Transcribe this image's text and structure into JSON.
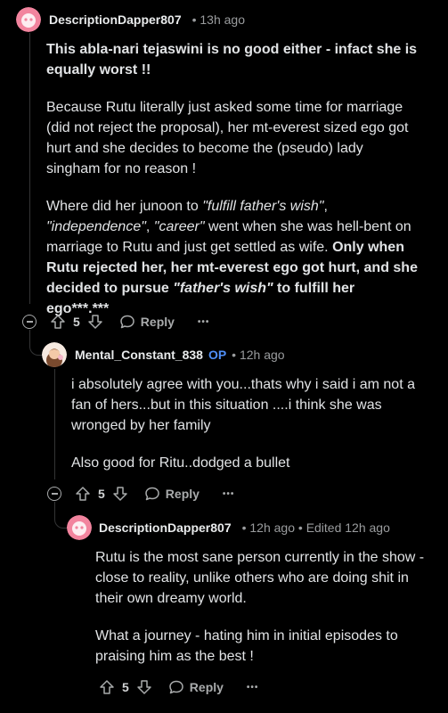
{
  "comments": [
    {
      "author": "DescriptionDapper807",
      "op": "",
      "meta": "• 13h ago",
      "paragraphs": [
        {
          "segments": [
            {
              "text": "This abla-nari tejaswini is no good either - infact she is equally worst !!",
              "style": "bold"
            }
          ]
        },
        {
          "segments": [
            {
              "text": "Because Rutu literally just asked some time for marriage (did not reject the proposal), her mt-everest sized ego got hurt and she decides to become the (pseudo) lady singham for no reason !",
              "style": "normal"
            }
          ]
        },
        {
          "segments": [
            {
              "text": "Where did her junoon to ",
              "style": "normal"
            },
            {
              "text": "\"fulfill father's wish\"",
              "style": "italic"
            },
            {
              "text": ", ",
              "style": "normal"
            },
            {
              "text": "\"independence\"",
              "style": "italic"
            },
            {
              "text": ", ",
              "style": "normal"
            },
            {
              "text": "\"career\"",
              "style": "italic"
            },
            {
              "text": " went when she was hell-bent on marriage to Rutu and just get settled as wife. ",
              "style": "normal"
            },
            {
              "text": "Only when Rutu rejected her, her mt-everest ego got hurt, and she decided to pursue ",
              "style": "bold"
            },
            {
              "text": "\"father's wish\"",
              "style": "bold-italic"
            },
            {
              "text": " to fulfill her ego***.***",
              "style": "bold"
            }
          ]
        }
      ],
      "score": "5",
      "reply_label": "Reply",
      "more_label": "•••"
    },
    {
      "author": "Mental_Constant_838",
      "op": "OP",
      "meta": "• 12h ago",
      "paragraphs": [
        {
          "segments": [
            {
              "text": "i absolutely agree with you...thats why i said i am not a fan of hers...but in this situation ....i think she was wronged by her family",
              "style": "normal"
            }
          ]
        },
        {
          "segments": [
            {
              "text": "Also good for Ritu..dodged a bullet",
              "style": "normal"
            }
          ]
        }
      ],
      "score": "5",
      "reply_label": "Reply",
      "more_label": "•••"
    },
    {
      "author": "DescriptionDapper807",
      "op": "",
      "meta": "• 12h ago • Edited 12h ago",
      "paragraphs": [
        {
          "segments": [
            {
              "text": "Rutu is the most sane person currently in the show - close to reality, unlike others who are doing shit in their own dreamy world.",
              "style": "normal"
            }
          ]
        },
        {
          "segments": [
            {
              "text": "What a journey - hating him in initial episodes to praising him as the best !",
              "style": "normal"
            }
          ]
        }
      ],
      "score": "5",
      "reply_label": "Reply",
      "more_label": "•••"
    }
  ],
  "colors": {
    "background": "#000000",
    "text": "#e1e3e5",
    "meta": "#9a9c9e",
    "op_badge": "#4f8ff7",
    "avatar_pink": "#f2849e"
  },
  "icons": [
    "upvote-icon",
    "downvote-icon",
    "reply-icon",
    "collapse-icon",
    "more-icon"
  ]
}
